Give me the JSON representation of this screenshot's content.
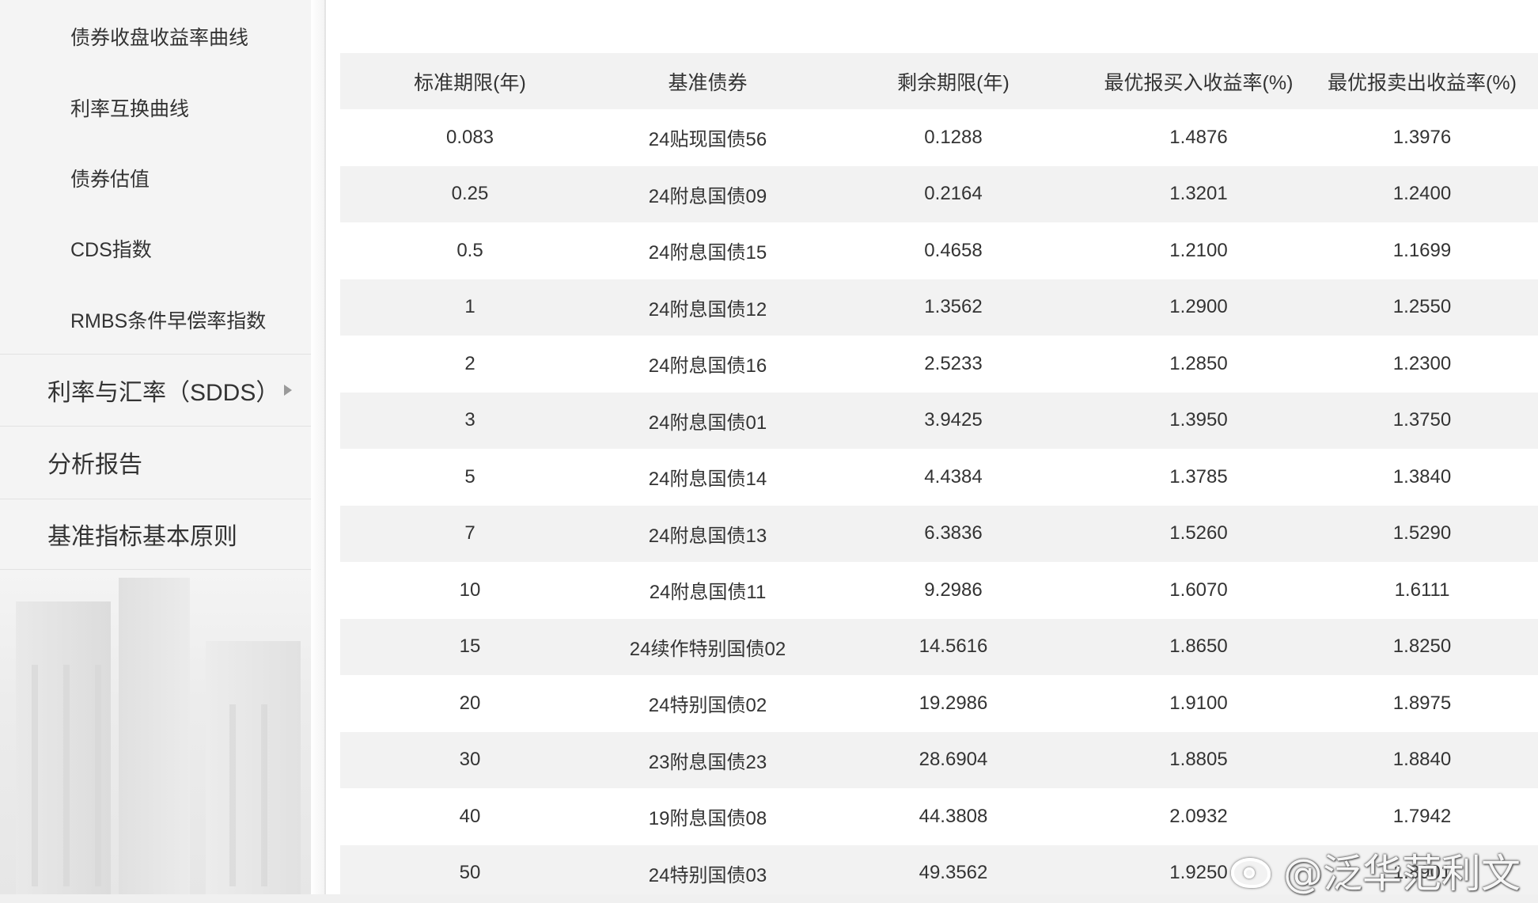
{
  "sidebar": {
    "sub_items": [
      {
        "label": "债券收盘收益率曲线"
      },
      {
        "label": "利率互换曲线"
      },
      {
        "label": "债券估值"
      },
      {
        "label": "CDS指数"
      },
      {
        "label": "RMBS条件早偿率指数"
      }
    ],
    "menu_items": [
      {
        "label": "利率与汇率（SDDS）",
        "icon": "triangle-right-icon"
      },
      {
        "label": "分析报告"
      },
      {
        "label": "基准指标基本原则"
      }
    ]
  },
  "table": {
    "headers": [
      "标准期限(年)",
      "基准债券",
      "剩余期限(年)",
      "最优报买入收益率(%)",
      "最优报卖出收益率(%)"
    ],
    "rows": [
      [
        "0.083",
        "24贴现国债56",
        "0.1288",
        "1.4876",
        "1.3976"
      ],
      [
        "0.25",
        "24附息国债09",
        "0.2164",
        "1.3201",
        "1.2400"
      ],
      [
        "0.5",
        "24附息国债15",
        "0.4658",
        "1.2100",
        "1.1699"
      ],
      [
        "1",
        "24附息国债12",
        "1.3562",
        "1.2900",
        "1.2550"
      ],
      [
        "2",
        "24附息国债16",
        "2.5233",
        "1.2850",
        "1.2300"
      ],
      [
        "3",
        "24附息国债01",
        "3.9425",
        "1.3950",
        "1.3750"
      ],
      [
        "5",
        "24附息国债14",
        "4.4384",
        "1.3785",
        "1.3840"
      ],
      [
        "7",
        "24附息国债13",
        "6.3836",
        "1.5260",
        "1.5290"
      ],
      [
        "10",
        "24附息国债11",
        "9.2986",
        "1.6070",
        "1.6111"
      ],
      [
        "15",
        "24续作特别国债02",
        "14.5616",
        "1.8650",
        "1.8250"
      ],
      [
        "20",
        "24特别国债02",
        "19.2986",
        "1.9100",
        "1.8975"
      ],
      [
        "30",
        "23附息国债23",
        "28.6904",
        "1.8805",
        "1.8840"
      ],
      [
        "40",
        "19附息国债08",
        "44.3808",
        "2.0932",
        "1.7942"
      ],
      [
        "50",
        "24特别国债03",
        "49.3562",
        "1.9250",
        "1.8901"
      ]
    ]
  },
  "watermark": {
    "text": "@泛华范利文",
    "icon": "weibo-icon"
  }
}
